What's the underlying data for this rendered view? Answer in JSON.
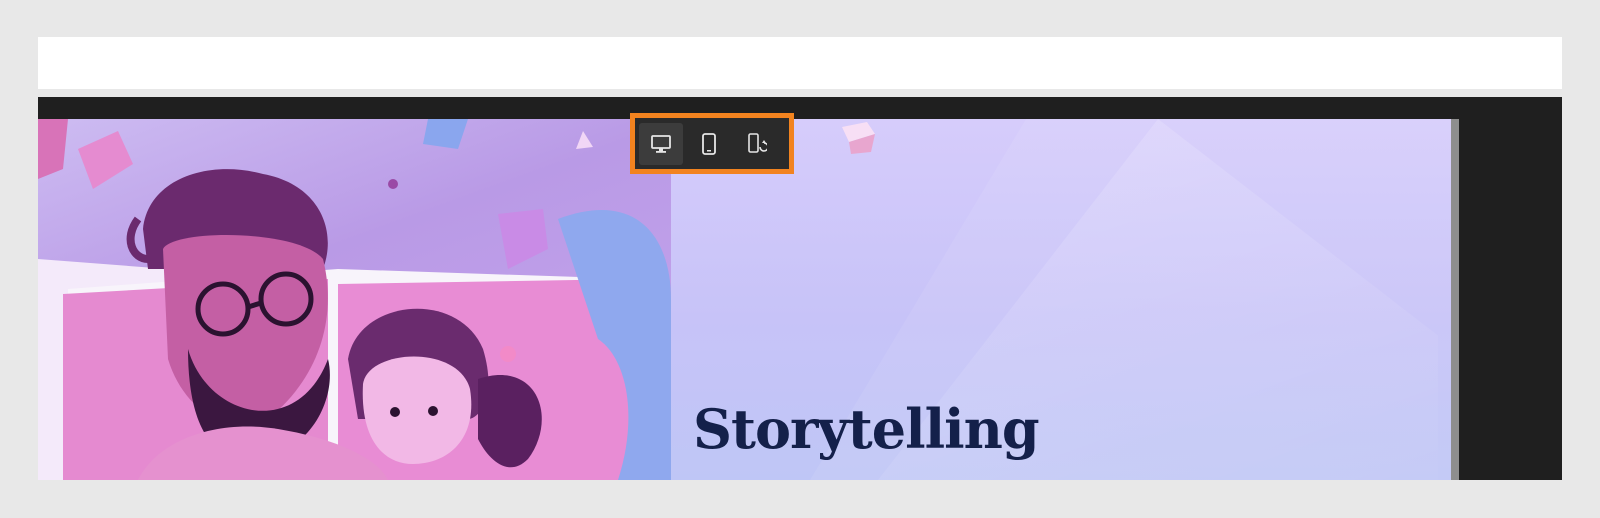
{
  "window": {
    "background": "#e8e8e8"
  },
  "editor": {
    "background": "#1f1f1f"
  },
  "device_toolbar": {
    "highlight_color": "#f2831f",
    "buttons": [
      {
        "name": "desktop",
        "icon": "monitor-icon",
        "active": true
      },
      {
        "name": "tablet",
        "icon": "tablet-icon",
        "active": false
      },
      {
        "name": "mobile-rotate",
        "icon": "mobile-rotate-icon",
        "active": false
      }
    ]
  },
  "preview": {
    "heading": "Storytelling",
    "heading_color": "#14204a",
    "image_description_icon": "illustration-image"
  }
}
